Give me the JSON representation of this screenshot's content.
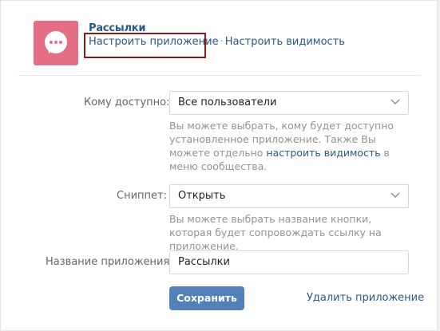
{
  "app": {
    "name": "Рассылки",
    "link_configure": "Настроить приложение",
    "separator": "·",
    "link_visibility": "Настроить видимость"
  },
  "form": {
    "availability": {
      "label": "Кому доступно:",
      "value": "Все пользователи",
      "hint_before": "Вы можете выбрать, кому будет доступно установленное приложение. Также Вы можете отдельно ",
      "hint_link": "настроить видимость",
      "hint_after": " в меню сообщества."
    },
    "snippet": {
      "label": "Сниппет:",
      "value": "Открыть",
      "hint": "Вы можете выбрать название кнопки, которая будет сопровождать ссылку на приложение."
    },
    "app_name": {
      "label": "Название приложения:",
      "value": "Рассылки"
    },
    "save_label": "Сохранить",
    "delete_label": "Удалить приложение"
  },
  "colors": {
    "accent": "#5181b8",
    "link": "#2a5885",
    "app_icon_bg": "#e46f84",
    "highlight_box": "#8b1a1a"
  },
  "icons": {
    "app_icon": "chat-bubble-icon",
    "dropdown": "chevron-down-icon"
  }
}
